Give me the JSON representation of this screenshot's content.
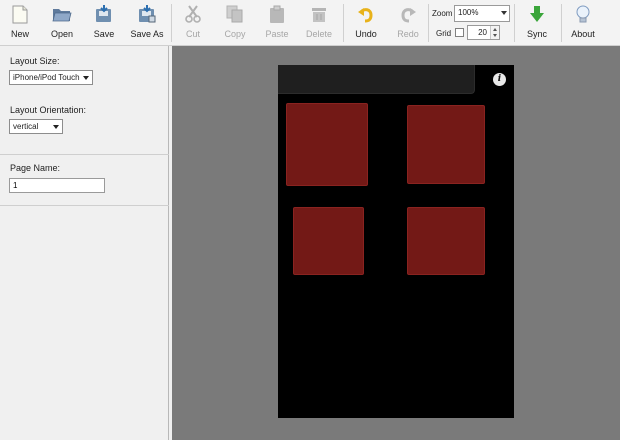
{
  "toolbar": {
    "new_label": "New",
    "open_label": "Open",
    "save_label": "Save",
    "saveas_label": "Save As",
    "cut_label": "Cut",
    "copy_label": "Copy",
    "paste_label": "Paste",
    "delete_label": "Delete",
    "undo_label": "Undo",
    "redo_label": "Redo",
    "zoom_label": "Zoom",
    "zoom_value": "100%",
    "grid_label": "Grid",
    "grid_checked": false,
    "grid_size": "20",
    "sync_label": "Sync",
    "about_label": "About"
  },
  "sidebar": {
    "layout_size_label": "Layout Size:",
    "layout_size_value": "iPhone/iPod Touch",
    "layout_orientation_label": "Layout Orientation:",
    "layout_orientation_value": "vertical",
    "page_name_label": "Page Name:",
    "page_name_value": "1"
  },
  "device": {
    "info_icon_glyph": "i",
    "pad_color": "#731916"
  },
  "colors": {
    "canvas_bg": "#7a7a7a",
    "device_bg": "#000000",
    "sync_green": "#3aa53a",
    "undo_yellow": "#e8b21a"
  }
}
